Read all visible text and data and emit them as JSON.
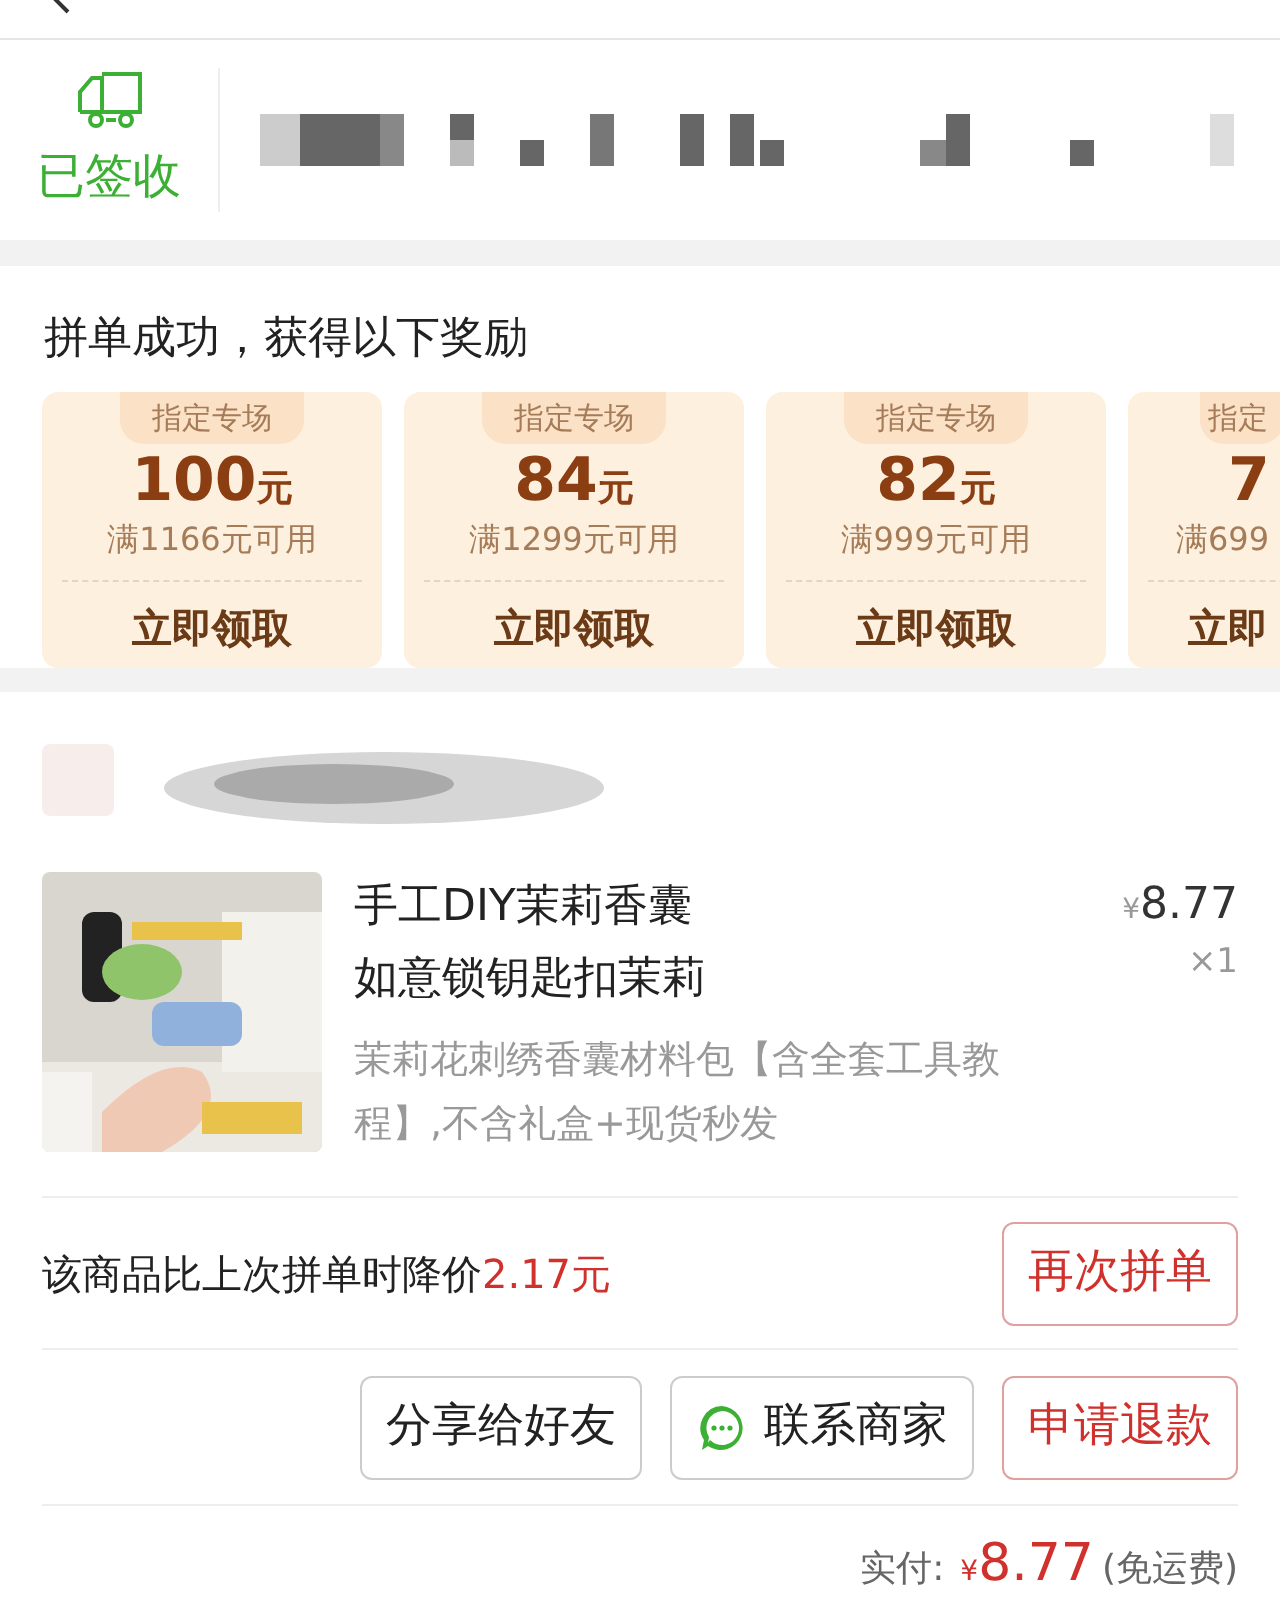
{
  "delivery": {
    "status": "已签收"
  },
  "rewards": {
    "title": "拼单成功，获得以下奖励",
    "coupons": [
      {
        "tag": "指定专场",
        "amount": "100",
        "unit": "元",
        "condition": "满1166元可用",
        "action": "立即领取"
      },
      {
        "tag": "指定专场",
        "amount": "84",
        "unit": "元",
        "condition": "满1299元可用",
        "action": "立即领取"
      },
      {
        "tag": "指定专场",
        "amount": "82",
        "unit": "元",
        "condition": "满999元可用",
        "action": "立即领取"
      },
      {
        "tag": "指定",
        "amount": "7",
        "condition": "满699",
        "action": "立即"
      }
    ]
  },
  "order": {
    "product": {
      "title_lines": [
        "手工DIY茉莉香囊",
        "如意锁钥匙扣茉莉"
      ],
      "spec": "茉莉花刺绣香囊材料包【含全套工具教程】,不含礼盒+现货秒发",
      "currency": "¥",
      "price": "8.77",
      "quantity": "×1"
    },
    "price_drop": {
      "text": "该商品比上次拼单时降价",
      "amount": "2.17元",
      "button": {
        "label": "再次拼单",
        "kind": "primary"
      }
    },
    "buttons": [
      {
        "label": "分享给好友",
        "kind": "plain"
      },
      {
        "label": "联系商家",
        "kind": "chat"
      },
      {
        "label": "申请退款",
        "kind": "primary"
      }
    ],
    "total": {
      "label": "实付:",
      "currency": "¥",
      "amount": "8.77",
      "note": "(免运费)"
    }
  }
}
